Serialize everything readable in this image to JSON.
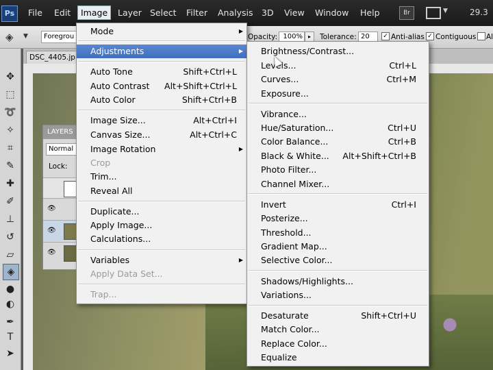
{
  "app": {
    "logo": "Ps",
    "zoom": "29.3",
    "bridge_label": "Br"
  },
  "menubar": {
    "items": [
      "File",
      "Edit",
      "Image",
      "Layer",
      "Select",
      "Filter",
      "Analysis",
      "3D",
      "View",
      "Window",
      "Help"
    ],
    "active": "Image"
  },
  "options": {
    "fill_source": "Foregrou",
    "opacity_label": "Opacity:",
    "opacity_value": "100%",
    "tolerance_label": "Tolerance:",
    "tolerance_value": "20",
    "anti_alias": "Anti-alias",
    "contiguous": "Contiguous",
    "all_layers": "Al"
  },
  "document": {
    "tab": "DSC_4405.jp"
  },
  "layers_panel": {
    "tab": "LAYERS",
    "mode": "Normal",
    "lock_label": "Lock:"
  },
  "image_menu": {
    "items": [
      {
        "label": "Mode",
        "shortcut": "",
        "submenu": true
      },
      {
        "label": "Adjustments",
        "shortcut": "",
        "submenu": true,
        "highlighted": true
      },
      {
        "label": "Auto Tone",
        "shortcut": "Shift+Ctrl+L"
      },
      {
        "label": "Auto Contrast",
        "shortcut": "Alt+Shift+Ctrl+L"
      },
      {
        "label": "Auto Color",
        "shortcut": "Shift+Ctrl+B"
      },
      {
        "label": "Image Size...",
        "shortcut": "Alt+Ctrl+I"
      },
      {
        "label": "Canvas Size...",
        "shortcut": "Alt+Ctrl+C"
      },
      {
        "label": "Image Rotation",
        "shortcut": "",
        "submenu": true
      },
      {
        "label": "Crop",
        "shortcut": "",
        "disabled": true
      },
      {
        "label": "Trim...",
        "shortcut": ""
      },
      {
        "label": "Reveal All",
        "shortcut": ""
      },
      {
        "label": "Duplicate...",
        "shortcut": ""
      },
      {
        "label": "Apply Image...",
        "shortcut": ""
      },
      {
        "label": "Calculations...",
        "shortcut": ""
      },
      {
        "label": "Variables",
        "shortcut": "",
        "submenu": true
      },
      {
        "label": "Apply Data Set...",
        "shortcut": "",
        "disabled": true
      },
      {
        "label": "Trap...",
        "shortcut": "",
        "disabled": true
      }
    ]
  },
  "adjustments_menu": {
    "items": [
      {
        "label": "Brightness/Contrast...",
        "shortcut": ""
      },
      {
        "label": "Levels...",
        "shortcut": "Ctrl+L"
      },
      {
        "label": "Curves...",
        "shortcut": "Ctrl+M"
      },
      {
        "label": "Exposure...",
        "shortcut": ""
      },
      {
        "label": "Vibrance...",
        "shortcut": ""
      },
      {
        "label": "Hue/Saturation...",
        "shortcut": "Ctrl+U"
      },
      {
        "label": "Color Balance...",
        "shortcut": "Ctrl+B"
      },
      {
        "label": "Black & White...",
        "shortcut": "Alt+Shift+Ctrl+B"
      },
      {
        "label": "Photo Filter...",
        "shortcut": ""
      },
      {
        "label": "Channel Mixer...",
        "shortcut": ""
      },
      {
        "label": "Invert",
        "shortcut": "Ctrl+I"
      },
      {
        "label": "Posterize...",
        "shortcut": ""
      },
      {
        "label": "Threshold...",
        "shortcut": ""
      },
      {
        "label": "Gradient Map...",
        "shortcut": ""
      },
      {
        "label": "Selective Color...",
        "shortcut": ""
      },
      {
        "label": "Shadows/Highlights...",
        "shortcut": ""
      },
      {
        "label": "Variations...",
        "shortcut": ""
      },
      {
        "label": "Desaturate",
        "shortcut": "Shift+Ctrl+U"
      },
      {
        "label": "Match Color...",
        "shortcut": ""
      },
      {
        "label": "Replace Color...",
        "shortcut": ""
      },
      {
        "label": "Equalize",
        "shortcut": ""
      }
    ]
  },
  "colors": {
    "menu_highlight": "#4a7bc8",
    "menubar_bg": "#222222",
    "menu_bg": "#f1f1f1"
  }
}
